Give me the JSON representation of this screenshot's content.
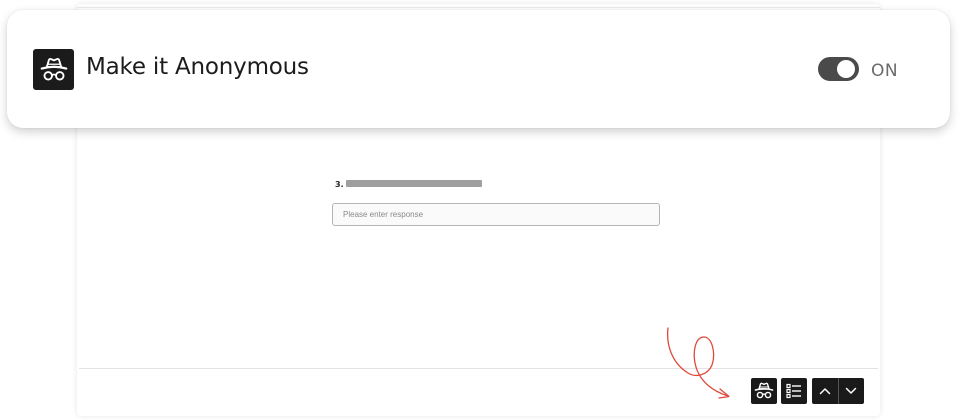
{
  "callout": {
    "title": "Make it Anonymous",
    "toggle_state": "ON",
    "toggle_on": true,
    "icon": "incognito-icon"
  },
  "question": {
    "number": "3.",
    "input_placeholder": "Please enter response",
    "input_value": ""
  },
  "footer": {
    "buttons": [
      {
        "icon": "incognito-icon"
      },
      {
        "icon": "list-icon"
      },
      {
        "icon": "chevron-up-icon"
      },
      {
        "icon": "chevron-down-icon"
      }
    ]
  },
  "colors": {
    "annotation_arrow": "#e0483a",
    "button_bg": "#1a1a1a",
    "toggle_track": "#4a4a4a"
  }
}
